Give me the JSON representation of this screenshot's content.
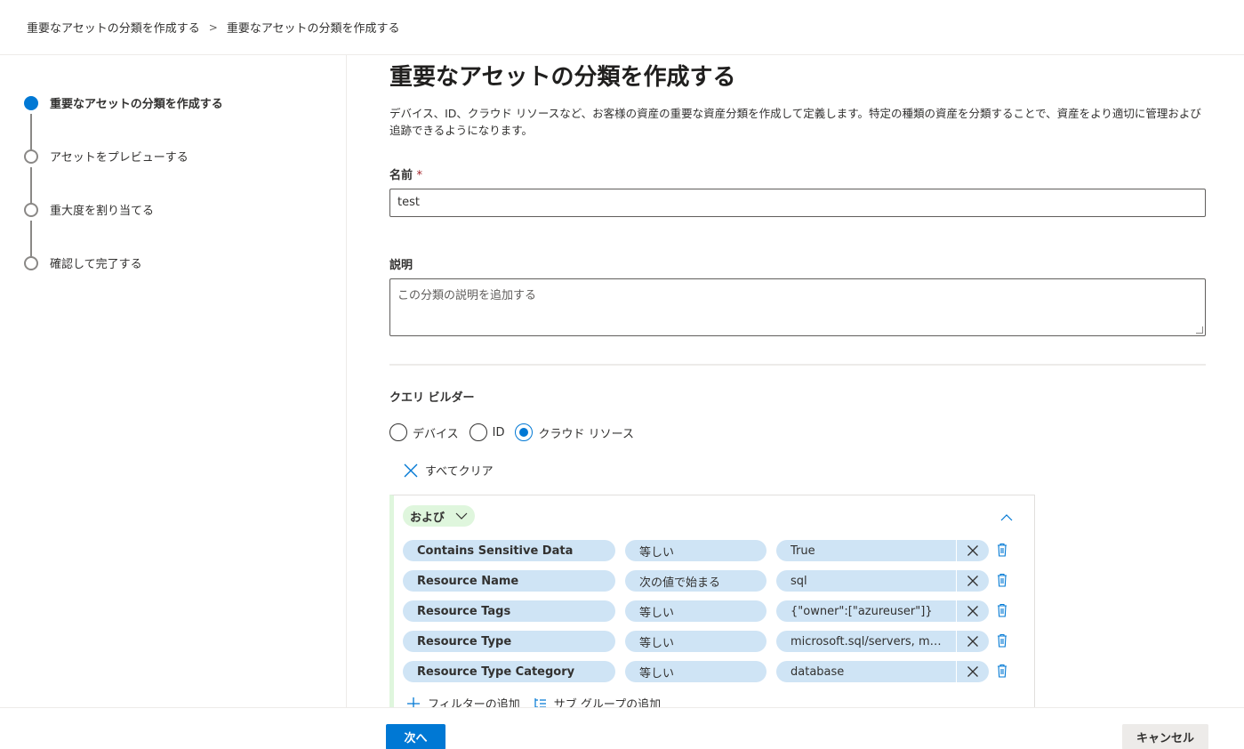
{
  "breadcrumb": {
    "items": [
      "重要なアセットの分類を作成する",
      "重要なアセットの分類を作成する"
    ],
    "separator": ">"
  },
  "wizard": {
    "steps": [
      {
        "label": "重要なアセットの分類を作成する",
        "active": true
      },
      {
        "label": "アセットをプレビューする",
        "active": false
      },
      {
        "label": "重大度を割り当てる",
        "active": false
      },
      {
        "label": "確認して完了する",
        "active": false
      }
    ]
  },
  "main": {
    "title": "重要なアセットの分類を作成する",
    "description": "デバイス、ID、クラウド リソースなど、お客様の資産の重要な資産分類を作成して定義します。特定の種類の資産を分類することで、資産をより適切に管理および追跡できるようになります。",
    "name_label": "名前",
    "required_marker": "*",
    "name_value": "test",
    "description_label": "説明",
    "description_placeholder": "この分類の説明を追加する"
  },
  "query_builder": {
    "title": "クエリ ビルダー",
    "radios": [
      {
        "label": "デバイス",
        "checked": false
      },
      {
        "label": "ID",
        "checked": false
      },
      {
        "label": "クラウド リソース",
        "checked": true
      }
    ],
    "clear_all": "すべてクリア",
    "group_operator": "および",
    "conditions": [
      {
        "field": "Contains Sensitive Data",
        "operator": "等しい",
        "value": "True"
      },
      {
        "field": "Resource Name",
        "operator": "次の値で始まる",
        "value": "sql"
      },
      {
        "field": "Resource Tags",
        "operator": "等しい",
        "value": "{\"owner\":[\"azureuser\"]}"
      },
      {
        "field": "Resource Type",
        "operator": "等しい",
        "value": "microsoft.sql/servers, microsoft.sql/servers/databases"
      },
      {
        "field": "Resource Type Category",
        "operator": "等しい",
        "value": "database"
      }
    ],
    "add_filter": "フィルターの追加",
    "add_subgroup": "サブ グループの追加"
  },
  "footer": {
    "next": "次へ",
    "cancel": "キャンセル"
  },
  "colors": {
    "accent": "#0078d4",
    "pill": "#cfe4f5",
    "group": "#dff6dd"
  }
}
